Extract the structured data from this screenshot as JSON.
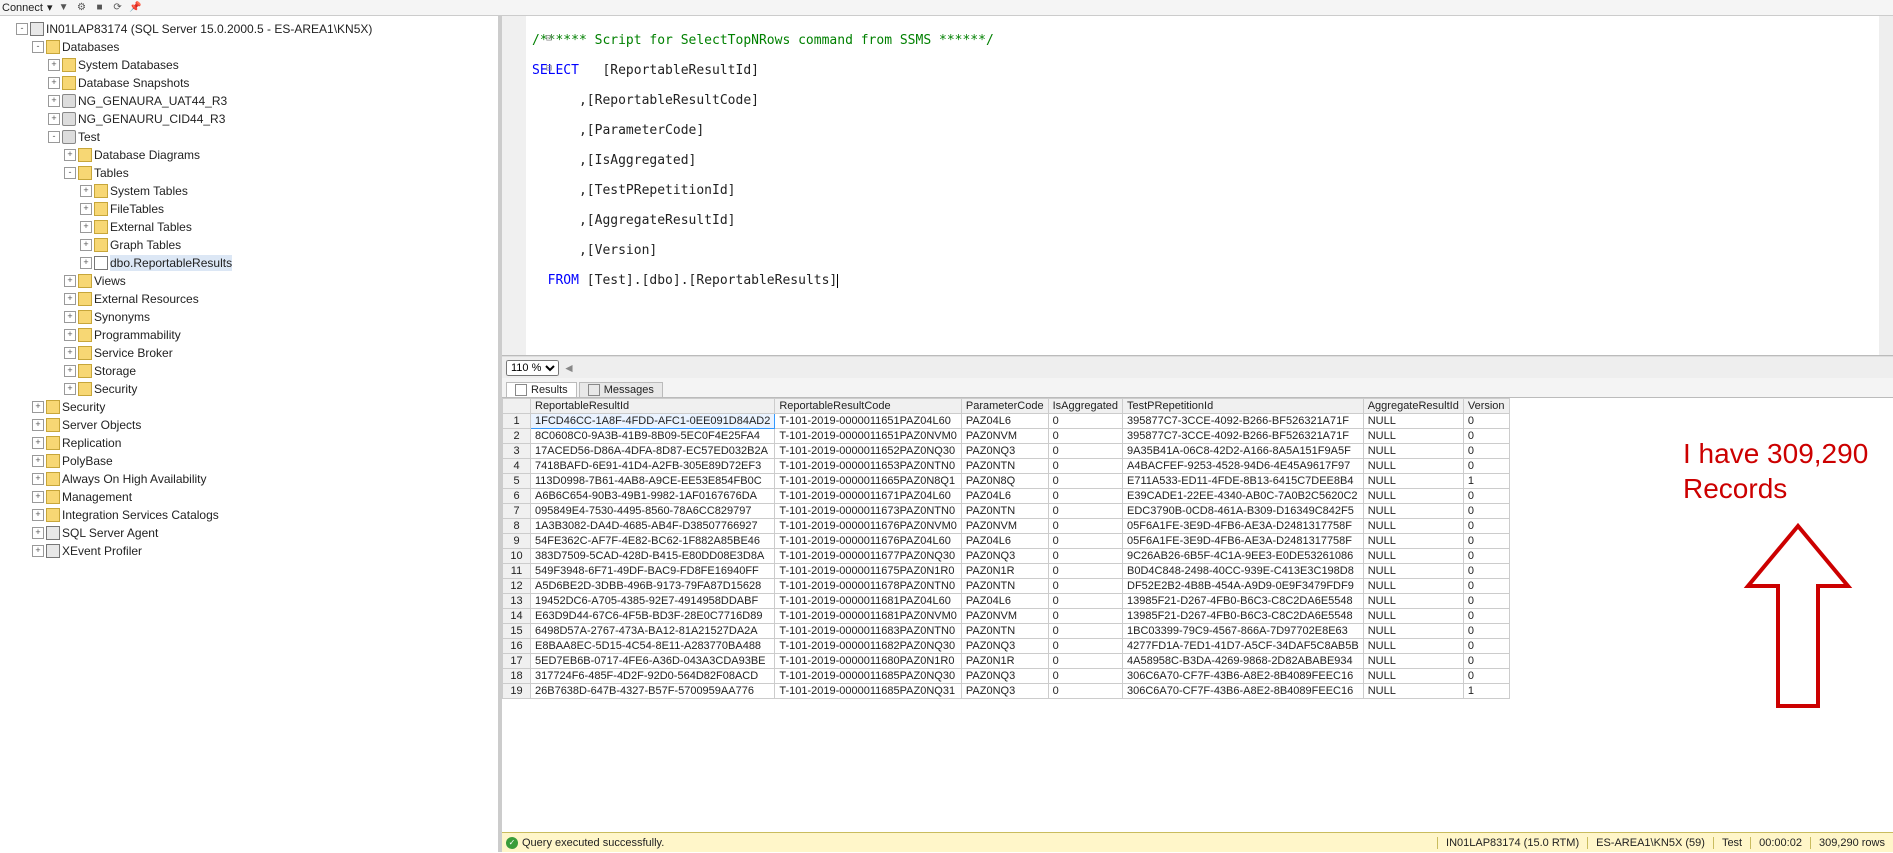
{
  "topbar": {
    "connect_label": "Connect",
    "dropdown": "▾"
  },
  "object_explorer": {
    "server": "IN01LAP83174 (SQL Server 15.0.2000.5 - ES-AREA1\\KN5X)",
    "databases_label": "Databases",
    "system_databases": "System Databases",
    "db_snapshots": "Database Snapshots",
    "db1": "NG_GENAURA_UAT44_R3",
    "db2": "NG_GENAURU_CID44_R3",
    "db_test": "Test",
    "db_diagrams": "Database Diagrams",
    "tables": "Tables",
    "system_tables": "System Tables",
    "filetables": "FileTables",
    "external_tables": "External Tables",
    "graph_tables": "Graph Tables",
    "user_table": "dbo.ReportableResults",
    "views": "Views",
    "ext_resources": "External Resources",
    "synonyms": "Synonyms",
    "programmability": "Programmability",
    "service_broker": "Service Broker",
    "storage": "Storage",
    "security_db": "Security",
    "security": "Security",
    "server_objects": "Server Objects",
    "replication": "Replication",
    "polybase": "PolyBase",
    "always_on": "Always On High Availability",
    "management": "Management",
    "isc": "Integration Services Catalogs",
    "agent": "SQL Server Agent",
    "xevent": "XEvent Profiler"
  },
  "sql": {
    "comment": "/****** Script for SelectTopNRows command from SSMS ******/",
    "select": "SELECT",
    "cols": [
      "   [ReportableResultId]",
      "      ,[ReportableResultCode]",
      "      ,[ParameterCode]",
      "      ,[IsAggregated]",
      "      ,[TestPRepetitionId]",
      "      ,[AggregateResultId]",
      "      ,[Version]"
    ],
    "from": "  FROM",
    "from_target": " [Test].[dbo].[ReportableResults]"
  },
  "zoom": {
    "value": "110 %"
  },
  "tabs": {
    "results": "Results",
    "messages": "Messages"
  },
  "grid": {
    "headers": [
      "",
      "ReportableResultId",
      "ReportableResultCode",
      "ParameterCode",
      "IsAggregated",
      "TestPRepetitionId",
      "AggregateResultId",
      "Version"
    ],
    "rows": [
      [
        "1",
        "1FCD46CC-1A8F-4FDD-AFC1-0EE091D84AD2",
        "T-101-2019-0000011651PAZ04L60",
        "PAZ04L6",
        "0",
        "395877C7-3CCE-4092-B266-BF526321A71F",
        "NULL",
        "0"
      ],
      [
        "2",
        "8C0608C0-9A3B-41B9-8B09-5EC0F4E25FA4",
        "T-101-2019-0000011651PAZ0NVM0",
        "PAZ0NVM",
        "0",
        "395877C7-3CCE-4092-B266-BF526321A71F",
        "NULL",
        "0"
      ],
      [
        "3",
        "17ACED56-D86A-4DFA-8D87-EC57ED032B2A",
        "T-101-2019-0000011652PAZ0NQ30",
        "PAZ0NQ3",
        "0",
        "9A35B41A-06C8-42D2-A166-8A5A151F9A5F",
        "NULL",
        "0"
      ],
      [
        "4",
        "7418BAFD-6E91-41D4-A2FB-305E89D72EF3",
        "T-101-2019-0000011653PAZ0NTN0",
        "PAZ0NTN",
        "0",
        "A4BACFEF-9253-4528-94D6-4E45A9617F97",
        "NULL",
        "0"
      ],
      [
        "5",
        "113D0998-7B61-4AB8-A9CE-EE53E854FB0C",
        "T-101-2019-0000011665PAZ0N8Q1",
        "PAZ0N8Q",
        "0",
        "E711A533-ED11-4FDE-8B13-6415C7DEE8B4",
        "NULL",
        "1"
      ],
      [
        "6",
        "A6B6C654-90B3-49B1-9982-1AF0167676DA",
        "T-101-2019-0000011671PAZ04L60",
        "PAZ04L6",
        "0",
        "E39CADE1-22EE-4340-AB0C-7A0B2C5620C2",
        "NULL",
        "0"
      ],
      [
        "7",
        "095849E4-7530-4495-8560-78A6CC829797",
        "T-101-2019-0000011673PAZ0NTN0",
        "PAZ0NTN",
        "0",
        "EDC3790B-0CD8-461A-B309-D16349C842F5",
        "NULL",
        "0"
      ],
      [
        "8",
        "1A3B3082-DA4D-4685-AB4F-D38507766927",
        "T-101-2019-0000011676PAZ0NVM0",
        "PAZ0NVM",
        "0",
        "05F6A1FE-3E9D-4FB6-AE3A-D2481317758F",
        "NULL",
        "0"
      ],
      [
        "9",
        "54FE362C-AF7F-4E82-BC62-1F882A85BE46",
        "T-101-2019-0000011676PAZ04L60",
        "PAZ04L6",
        "0",
        "05F6A1FE-3E9D-4FB6-AE3A-D2481317758F",
        "NULL",
        "0"
      ],
      [
        "10",
        "383D7509-5CAD-428D-B415-E80DD08E3D8A",
        "T-101-2019-0000011677PAZ0NQ30",
        "PAZ0NQ3",
        "0",
        "9C26AB26-6B5F-4C1A-9EE3-E0DE53261086",
        "NULL",
        "0"
      ],
      [
        "11",
        "549F3948-6F71-49DF-BAC9-FD8FE16940FF",
        "T-101-2019-0000011675PAZ0N1R0",
        "PAZ0N1R",
        "0",
        "B0D4C848-2498-40CC-939E-C413E3C198D8",
        "NULL",
        "0"
      ],
      [
        "12",
        "A5D6BE2D-3DBB-496B-9173-79FA87D15628",
        "T-101-2019-0000011678PAZ0NTN0",
        "PAZ0NTN",
        "0",
        "DF52E2B2-4B8B-454A-A9D9-0E9F3479FDF9",
        "NULL",
        "0"
      ],
      [
        "13",
        "19452DC6-A705-4385-92E7-4914958DDABF",
        "T-101-2019-0000011681PAZ04L60",
        "PAZ04L6",
        "0",
        "13985F21-D267-4FB0-B6C3-C8C2DA6E5548",
        "NULL",
        "0"
      ],
      [
        "14",
        "E63D9D44-67C6-4F5B-BD3F-28E0C7716D89",
        "T-101-2019-0000011681PAZ0NVM0",
        "PAZ0NVM",
        "0",
        "13985F21-D267-4FB0-B6C3-C8C2DA6E5548",
        "NULL",
        "0"
      ],
      [
        "15",
        "6498D57A-2767-473A-BA12-81A21527DA2A",
        "T-101-2019-0000011683PAZ0NTN0",
        "PAZ0NTN",
        "0",
        "1BC03399-79C9-4567-866A-7D97702E8E63",
        "NULL",
        "0"
      ],
      [
        "16",
        "E8BAA8EC-5D15-4C54-8E11-A283770BA488",
        "T-101-2019-0000011682PAZ0NQ30",
        "PAZ0NQ3",
        "0",
        "4277FD1A-7ED1-41D7-A5CF-34DAF5C8AB5B",
        "NULL",
        "0"
      ],
      [
        "17",
        "5ED7EB6B-0717-4FE6-A36D-043A3CDA93BE",
        "T-101-2019-0000011680PAZ0N1R0",
        "PAZ0N1R",
        "0",
        "4A58958C-B3DA-4269-9868-2D82ABABE934",
        "NULL",
        "0"
      ],
      [
        "18",
        "317724F6-485F-4D2F-92D0-564D82F08ACD",
        "T-101-2019-0000011685PAZ0NQ30",
        "PAZ0NQ3",
        "0",
        "306C6A70-CF7F-43B6-A8E2-8B4089FEEC16",
        "NULL",
        "0"
      ],
      [
        "19",
        "26B7638D-647B-4327-B57F-5700959AA776",
        "T-101-2019-0000011685PAZ0NQ31",
        "PAZ0NQ3",
        "0",
        "306C6A70-CF7F-43B6-A8E2-8B4089FEEC16",
        "NULL",
        "1"
      ]
    ]
  },
  "status": {
    "ok": "✓",
    "msg": "Query executed successfully.",
    "server": "IN01LAP83174 (15.0 RTM)",
    "login": "ES-AREA1\\KN5X (59)",
    "db": "Test",
    "time": "00:00:02",
    "rows": "309,290 rows"
  },
  "annotation": {
    "text": "I have 309,290 Records"
  }
}
